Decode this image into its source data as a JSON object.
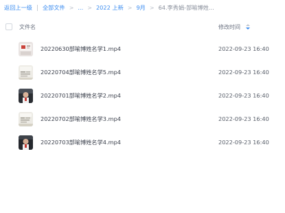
{
  "breadcrumb": {
    "back": "返回上一级",
    "all_files": "全部文件",
    "ellipsis": "...",
    "year": "2022 上新",
    "month": "9月",
    "current": "64.李秀娟-部喻博姓..."
  },
  "header": {
    "name_col": "文件名",
    "time_col": "修改时间",
    "sort_icon": "sort-desc-icon"
  },
  "files": [
    {
      "name": "20220630部喻博姓名学1.mp4",
      "time": "2022-09-23 16:40",
      "thumb": "video-thumbnail-1"
    },
    {
      "name": "20220704部喻博姓名学5.mp4",
      "time": "2022-09-23 16:40",
      "thumb": "video-thumbnail-2"
    },
    {
      "name": "20220701部喻博姓名学2.mp4",
      "time": "2022-09-23 16:40",
      "thumb": "video-thumbnail-3"
    },
    {
      "name": "20220702部喻博姓名学3.mp4",
      "time": "2022-09-23 16:40",
      "thumb": "video-thumbnail-4"
    },
    {
      "name": "20220703部喻博姓名学4.mp4",
      "time": "2022-09-23 16:40",
      "thumb": "video-thumbnail-5"
    }
  ],
  "colors": {
    "accent": "#3b8cf0",
    "text": "#3a3f4b",
    "muted": "#8a909c"
  }
}
